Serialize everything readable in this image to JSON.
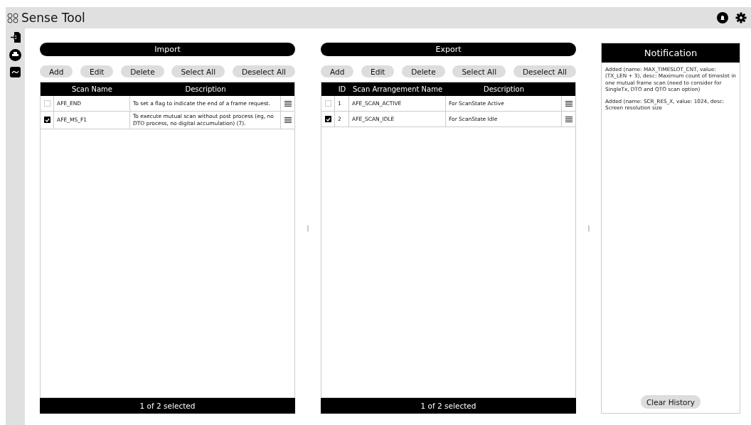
{
  "app": {
    "title": "Sense Tool"
  },
  "import_panel": {
    "title": "Import",
    "buttons": [
      "Add",
      "Edit",
      "Delete",
      "Select All",
      "Deselect All"
    ],
    "columns": [
      "Scan Name",
      "Description"
    ],
    "rows": [
      {
        "checked": false,
        "cells": [
          "AFE_END",
          "To set a flag to indicate the end of a frame request."
        ]
      },
      {
        "checked": true,
        "cells": [
          "AFE_MS_F1",
          "To execute mutual scan without post process (eg, no DTO process, no digital accumulation) (7)."
        ]
      }
    ],
    "footer": "1 of 2 selected"
  },
  "export_panel": {
    "title": "Export",
    "buttons": [
      "Add",
      "Edit",
      "Delete",
      "Select All",
      "Deselect All"
    ],
    "columns": [
      "ID",
      "Scan Arrangement Name",
      "Description"
    ],
    "rows": [
      {
        "checked": false,
        "cells": [
          "1",
          "AFE_SCAN_ACTIVE",
          "For ScanState Active"
        ]
      },
      {
        "checked": true,
        "cells": [
          "2",
          "AFE_SCAN_IDLE",
          "For ScanState Idle"
        ]
      }
    ],
    "footer": "1 of 2 selected"
  },
  "notification": {
    "title": "Notification",
    "messages": [
      "Added (name: MAX_TIMESLOT_CNT, value: (TX_LEN + 3), desc: Maximum count of timeslot in one mutual frame scan (need to consider for SingleTx, DTO and QTO scan option)",
      "Added (name: SCR_RES_X, value: 1024, desc: Screen resolution size"
    ],
    "button": "Clear History"
  }
}
